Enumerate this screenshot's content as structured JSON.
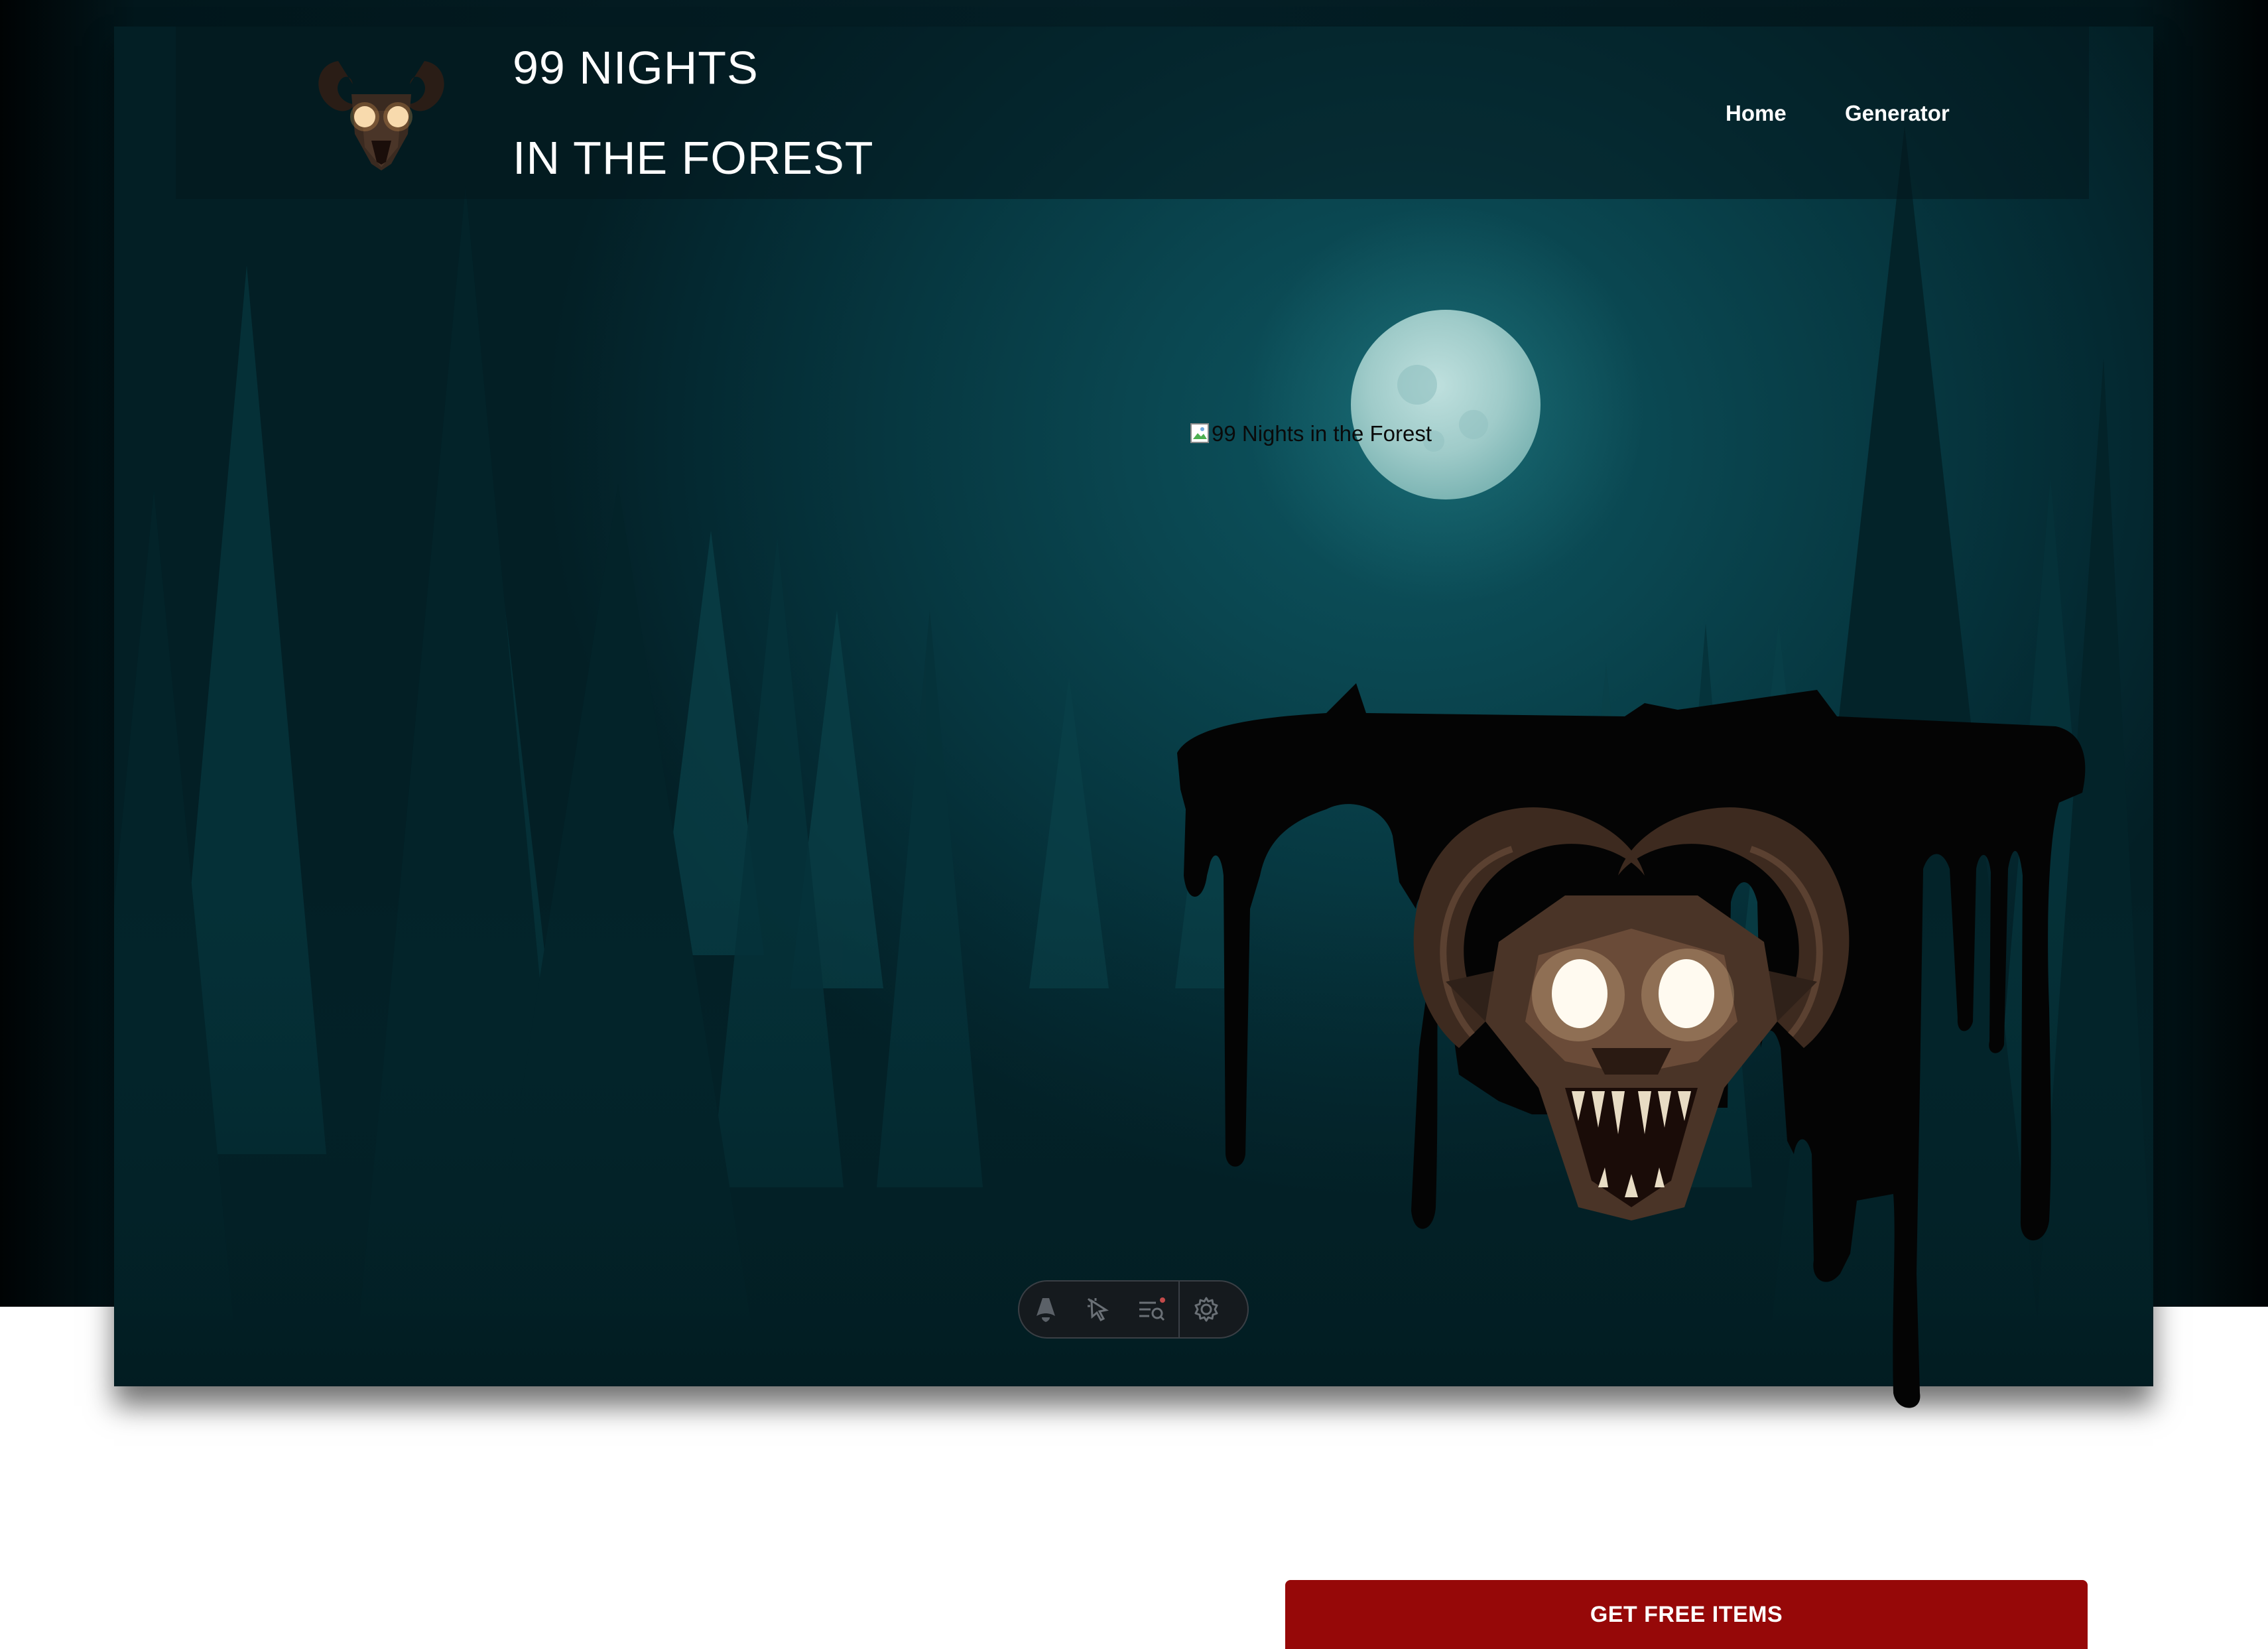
{
  "brand": {
    "title_line1": "99 NIGHTS",
    "title_line2": "IN THE FOREST",
    "logo_icon": "goat-demon-head-icon"
  },
  "nav": {
    "items": [
      {
        "label": "Home"
      },
      {
        "label": "Generator"
      }
    ]
  },
  "hero": {
    "image_alt": "99 Nights in the Forest",
    "mascot_icon": "goat-demon-head-icon"
  },
  "devtoolbar": {
    "icons": [
      "astro-logo-icon",
      "pointer-inspect-icon",
      "audit-list-icon",
      "gear-icon"
    ]
  },
  "cta": {
    "label": "GET FREE ITEMS"
  },
  "colors": {
    "cta_background": "#960808",
    "scene_teal": "#0a4650",
    "text": "#ffffff"
  }
}
